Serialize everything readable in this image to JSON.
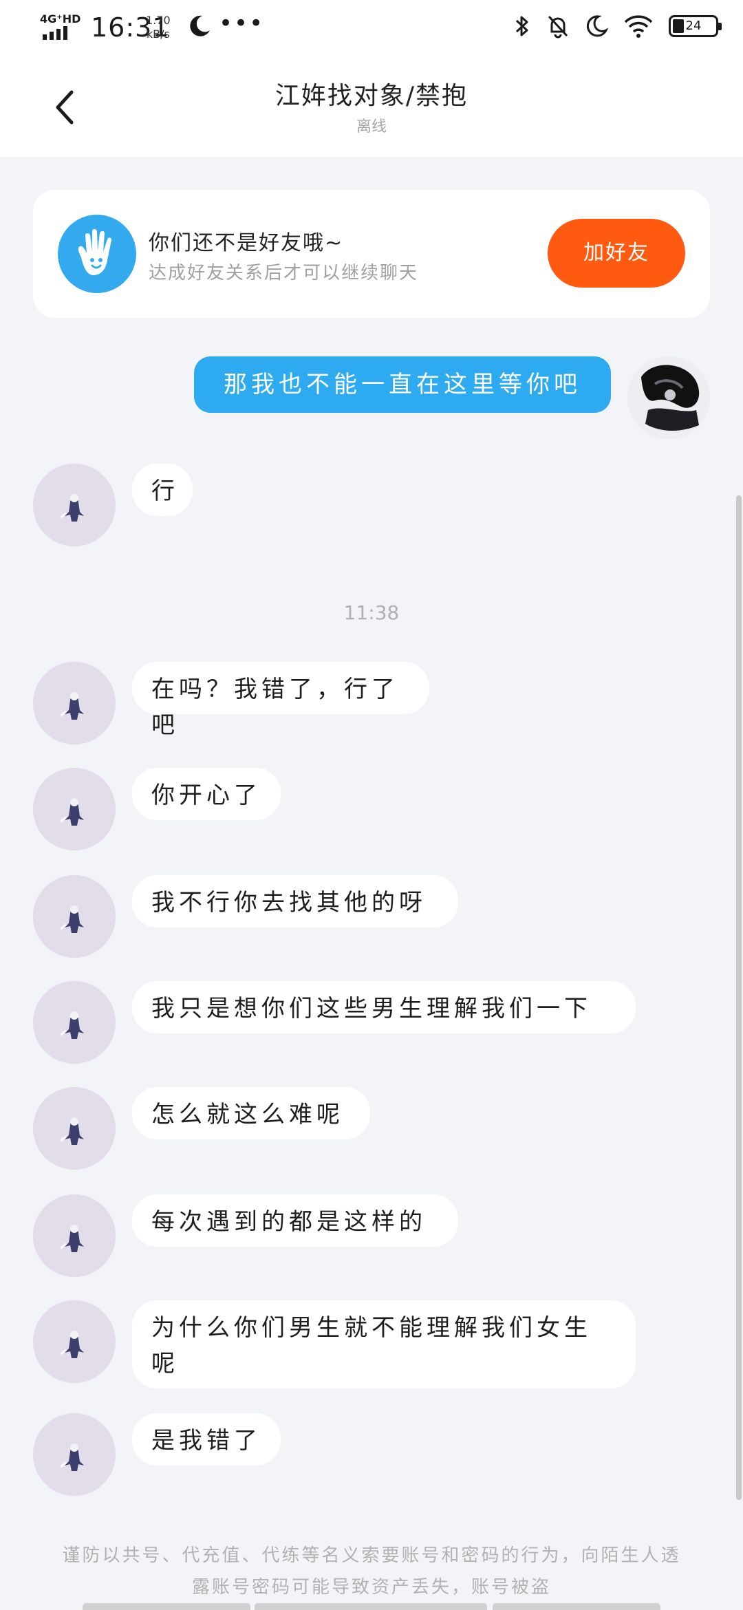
{
  "status_bar": {
    "network": "4G⁺HD",
    "time": "16:31",
    "speed_value": "1.70",
    "speed_unit": "kB/s",
    "battery": "24"
  },
  "header": {
    "back_icon": "chevron-left-icon",
    "title": "江姩找对象/禁抱",
    "status": "离线"
  },
  "friend_card": {
    "title": "你们还不是好友哦~",
    "subtitle": "达成好友关系后才可以继续聊天",
    "button": "加好友"
  },
  "messages": [
    {
      "from": "me",
      "text": "那我也不能一直在这里等你吧"
    },
    {
      "from": "other",
      "text": "行"
    },
    {
      "time": "11:38"
    },
    {
      "from": "other",
      "text": "在吗？我错了，行了吧"
    },
    {
      "from": "other",
      "text": "你开心了"
    },
    {
      "from": "other",
      "text": "我不行你去找其他的呀"
    },
    {
      "from": "other",
      "text": "我只是想你们这些男生理解我们一下"
    },
    {
      "from": "other",
      "text": "怎么就这么难呢"
    },
    {
      "from": "other",
      "text": "每次遇到的都是这样的"
    },
    {
      "from": "other",
      "text": "为什么你们男生就不能理解我们女生呢"
    },
    {
      "from": "other",
      "text": "是我错了"
    }
  ],
  "warning": "谨防以共号、代充值、代练等名义索要账号和密码的行为，向陌生人透露账号密码可能导致资产丢失，账号被盗",
  "colors": {
    "accent_blue": "#2EABF0",
    "button_orange": "#FF5A0F",
    "background": "#F2F4F7"
  }
}
